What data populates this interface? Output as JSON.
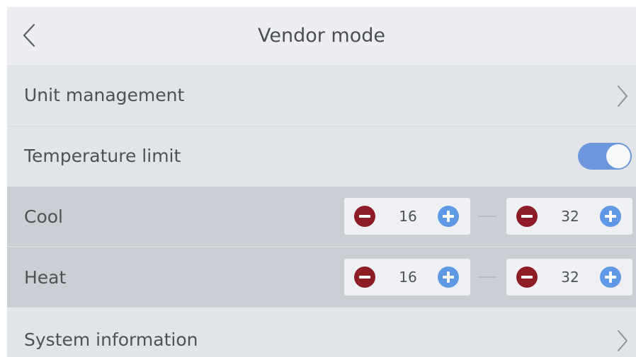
{
  "header": {
    "title": "Vendor mode",
    "back_icon": "chevron-left-icon"
  },
  "menu": {
    "unit_management": "Unit management",
    "temperature_limit": "Temperature limit",
    "temperature_limit_enabled": true,
    "cool": {
      "label": "Cool",
      "min": "16",
      "max": "32"
    },
    "heat": {
      "label": "Heat",
      "min": "16",
      "max": "32"
    },
    "system_information": "System information"
  },
  "colors": {
    "toggle_on": "#6c97dc",
    "minus_button": "#8e1c27",
    "plus_button": "#5f98e4"
  }
}
